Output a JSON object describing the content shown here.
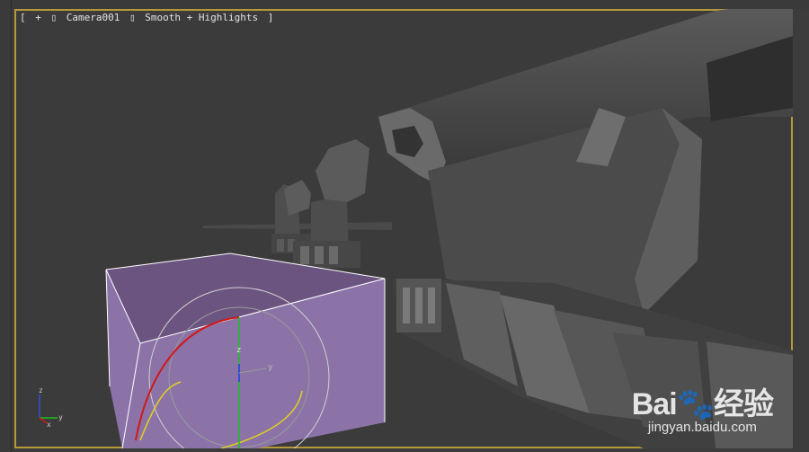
{
  "viewport": {
    "label_items": [
      "[",
      "+",
      "▯",
      "Camera001",
      "▯",
      "Smooth + Highlights",
      "]"
    ],
    "view_name": "Camera001",
    "shading_mode": "Smooth + Highlights",
    "border_color": "#b5993a"
  },
  "gizmo": {
    "z_label": "z",
    "y_label": "y"
  },
  "axis_tripod": {
    "z_label": "z",
    "y_label": "y",
    "x_label": "x"
  },
  "watermark": {
    "brand_latin": "Bai",
    "brand_cn": "经验",
    "url": "jingyan.baidu.com"
  },
  "colors": {
    "viewport_bg": "#3b3b3b",
    "selected_box": "#8b73a8",
    "selected_box_top": "#6b5580",
    "gizmo_red": "#d01818",
    "gizmo_yellow": "#e0d020",
    "gizmo_green": "#20c020",
    "gizmo_blue": "#3050d0"
  }
}
